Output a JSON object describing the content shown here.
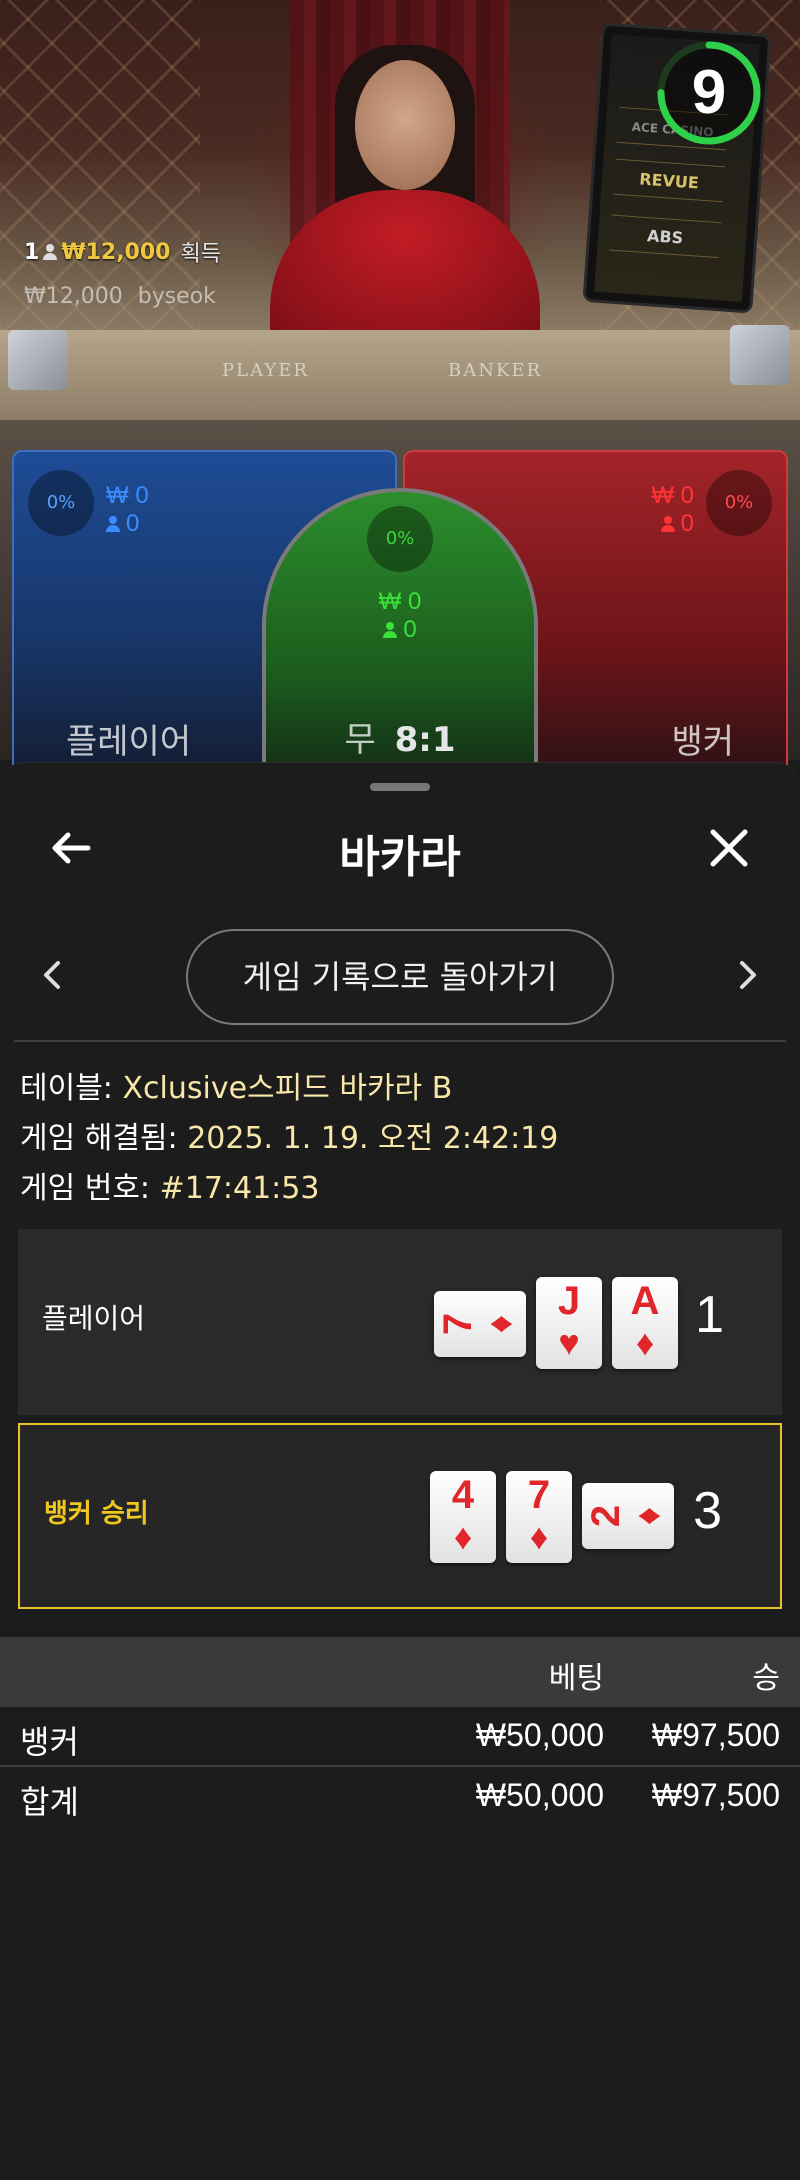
{
  "video": {
    "timer_value": "9",
    "timer_fraction": 0.75,
    "felt_player": "PLAYER",
    "felt_banker": "BANKER",
    "monitor_logos": [
      "ACE CASINO",
      "REVUE",
      "ABS"
    ],
    "win_count": "1",
    "win_amount": "₩12,000",
    "win_label": "획득",
    "winner_amount": "₩12,000",
    "winner_name": "byseok"
  },
  "bet_spots": {
    "player": {
      "percent": "0%",
      "amount": "₩ 0",
      "players": "0",
      "label": "플레이어"
    },
    "tie": {
      "percent": "0%",
      "amount": "₩ 0",
      "players": "0",
      "label": "무",
      "payout": "8:1"
    },
    "banker": {
      "percent": "0%",
      "amount": "₩ 0",
      "players": "0",
      "label": "뱅커"
    }
  },
  "sheet": {
    "title": "바카라",
    "back_history_label": "게임 기록으로 돌아가기",
    "table_label": "테이블: ",
    "table_value": "Xclusive스피드 바카라 B",
    "resolved_label": "게임 해결됨: ",
    "resolved_value": "2025. 1. 19. 오전 2:42:19",
    "game_no_label": "게임 번호: ",
    "game_no_value": "#17:41:53"
  },
  "hands": {
    "player": {
      "label": "플레이어",
      "score": "1",
      "cards": [
        {
          "rank": "J",
          "suit": "♥"
        },
        {
          "rank": "A",
          "suit": "♦"
        }
      ],
      "third_card": {
        "rank": "7",
        "suit": "♦"
      }
    },
    "banker": {
      "label": "뱅커 승리",
      "score": "3",
      "cards": [
        {
          "rank": "4",
          "suit": "♦"
        },
        {
          "rank": "7",
          "suit": "♦"
        }
      ],
      "third_card": {
        "rank": "2",
        "suit": "♦"
      }
    }
  },
  "bets_table": {
    "headers": [
      "",
      "베팅",
      "승"
    ],
    "rows": [
      {
        "name": "뱅커",
        "bet": "₩50,000",
        "win": "₩97,500"
      },
      {
        "name": "합계",
        "bet": "₩50,000",
        "win": "₩97,500"
      }
    ]
  },
  "colors": {
    "player": "#1e4c96",
    "banker": "#a32429",
    "tie": "#2c8e2c",
    "accent": "#f0c71f",
    "value_text": "#f8e7a8"
  }
}
